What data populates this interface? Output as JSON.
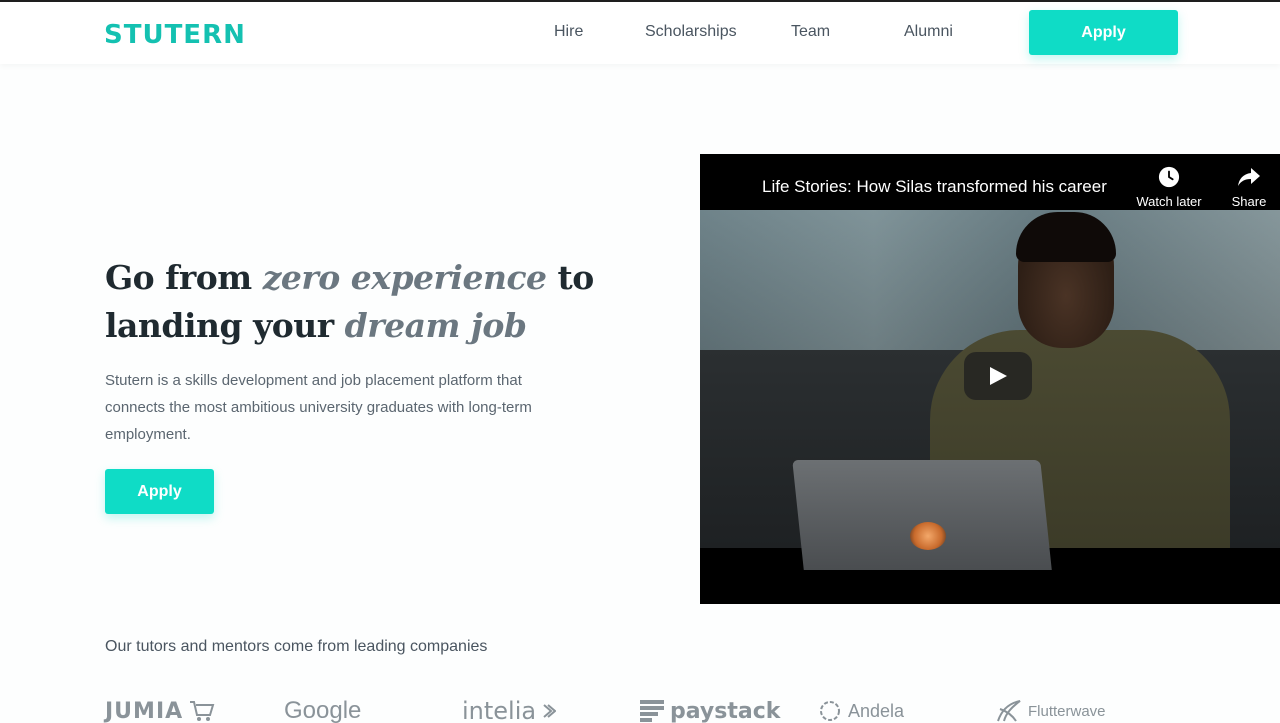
{
  "nav": {
    "logo": "STUTERN",
    "links": [
      "Hire",
      "Scholarships",
      "Team",
      "Alumni"
    ],
    "apply_label": "Apply"
  },
  "hero": {
    "title_part1": "Go from ",
    "title_em1": "zero experience",
    "title_part2": " to landing your ",
    "title_em2": "dream job",
    "description": "Stutern is a skills development and job placement platform that connects the most ambitious university graduates with long-term employment.",
    "apply_label": "Apply"
  },
  "video": {
    "title": "Life Stories: How Silas transformed his career",
    "watch_later_label": "Watch later",
    "share_label": "Share",
    "icons": {
      "watch_later": "clock-icon",
      "share": "share-arrow-icon",
      "play": "play-icon"
    }
  },
  "partners": {
    "heading": "Our tutors and mentors come from leading companies",
    "logos": [
      "JUMIA",
      "Google",
      "intelia",
      "paystack",
      "Andela",
      "Flutterwave"
    ]
  },
  "colors": {
    "brand": "#14c1b1",
    "button": "#0fdcc6"
  }
}
